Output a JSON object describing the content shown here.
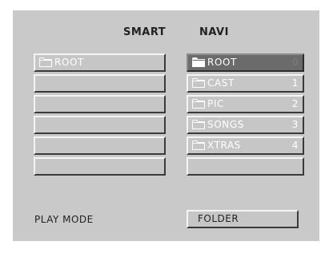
{
  "header": {
    "smart": "SMART",
    "navi": "NAVI"
  },
  "smart_list": [
    {
      "label": "ROOT",
      "icon": "folder-icon"
    },
    {
      "label": ""
    },
    {
      "label": ""
    },
    {
      "label": ""
    },
    {
      "label": ""
    },
    {
      "label": ""
    }
  ],
  "navi_list": [
    {
      "label": "ROOT",
      "number": "0",
      "icon": "folder-icon",
      "selected": true
    },
    {
      "label": "CAST",
      "number": "1",
      "icon": "folder-icon"
    },
    {
      "label": "PIC",
      "number": "2",
      "icon": "folder-icon"
    },
    {
      "label": "SONGS",
      "number": "3",
      "icon": "folder-icon"
    },
    {
      "label": "XTRAS",
      "number": "4",
      "icon": "folder-icon"
    },
    {
      "label": ""
    }
  ],
  "play_mode": {
    "label": "PLAY MODE",
    "value": "FOLDER"
  },
  "colors": {
    "screen_bg": "#c9c9c9",
    "selected_bg": "#6b6b6b",
    "text_light": "#ffffff",
    "text_dark": "#222222"
  }
}
